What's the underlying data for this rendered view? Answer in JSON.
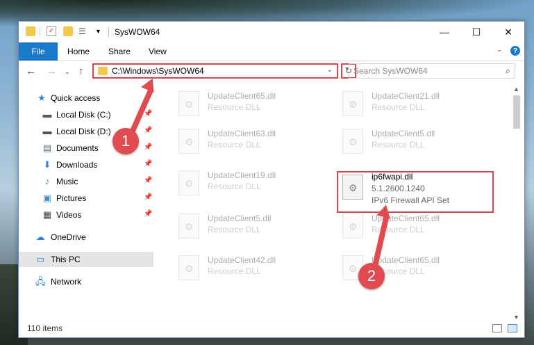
{
  "window": {
    "title": "SysWOW64"
  },
  "ribbon": {
    "tabs": [
      "File",
      "Home",
      "Share",
      "View"
    ],
    "help": "?"
  },
  "address": {
    "path": "C:\\Windows\\SysWOW64"
  },
  "search": {
    "placeholder": "Search SysWOW64"
  },
  "sidebar": {
    "items": [
      {
        "label": "Quick access",
        "icon": "star-icon"
      },
      {
        "label": "Local Disk (C:)",
        "icon": "drive-icon"
      },
      {
        "label": "Local Disk (D:)",
        "icon": "drive-icon"
      },
      {
        "label": "Documents",
        "icon": "documents-icon"
      },
      {
        "label": "Downloads",
        "icon": "downloads-icon"
      },
      {
        "label": "Music",
        "icon": "music-icon"
      },
      {
        "label": "Pictures",
        "icon": "pictures-icon"
      },
      {
        "label": "Videos",
        "icon": "videos-icon"
      },
      {
        "label": "OneDrive",
        "icon": "cloud-icon"
      },
      {
        "label": "This PC",
        "icon": "pc-icon"
      },
      {
        "label": "Network",
        "icon": "network-icon"
      }
    ]
  },
  "files": [
    {
      "name": "UpdateClient65.dll",
      "type": "Resource DLL"
    },
    {
      "name": "UpdateClient21.dll",
      "type": "Resource DLL"
    },
    {
      "name": "UpdateClient63.dll",
      "type": "Resource DLL"
    },
    {
      "name": "UpdateClient5.dll",
      "type": "Resource DLL"
    },
    {
      "name": "UpdateClient19.dll",
      "type": "Resource DLL"
    },
    {
      "name": "ip6fwapi.dll",
      "version": "5.1.2600.1240",
      "description": "IPv6 Firewall API Set"
    },
    {
      "name": "UpdateClient5.dll",
      "type": "Resource DLL"
    },
    {
      "name": "UpdateClient65.dll",
      "type": "Resource DLL"
    },
    {
      "name": "UpdateClient42.dll",
      "type": "Resource DLL"
    },
    {
      "name": "UpdateClient65.dll",
      "type": "Resource DLL"
    }
  ],
  "status": {
    "items": "110 items"
  },
  "annotations": {
    "badge1": "1",
    "badge2": "2",
    "color": "#e14a4e"
  }
}
